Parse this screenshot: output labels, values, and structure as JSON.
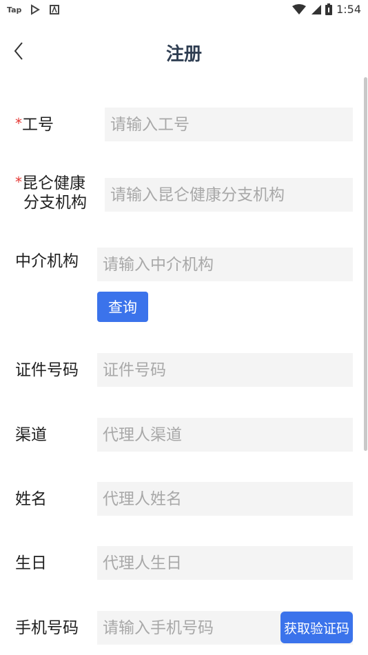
{
  "status_bar": {
    "app": "Tap",
    "time": "1:54"
  },
  "header": {
    "title": "注册"
  },
  "form": {
    "required_mark": "*",
    "employee_id": {
      "label": "工号",
      "placeholder": "请输入工号"
    },
    "branch": {
      "label_line1": "昆仑健康",
      "label_line2": "分支机构",
      "placeholder": "请输入昆仑健康分支机构"
    },
    "agency": {
      "label": "中介机构",
      "placeholder": "请输入中介机构"
    },
    "query_button": "查询",
    "id_number": {
      "label": "证件号码",
      "placeholder": "证件号码"
    },
    "channel": {
      "label": "渠道",
      "placeholder": "代理人渠道"
    },
    "name": {
      "label": "姓名",
      "placeholder": "代理人姓名"
    },
    "birthday": {
      "label": "生日",
      "placeholder": "代理人生日"
    },
    "phone": {
      "label": "手机号码",
      "placeholder": "请输入手机号码"
    },
    "get_code_button": "获取验证码"
  },
  "colors": {
    "primary": "#3b73eb",
    "required": "#e53935",
    "title": "#2f3e52",
    "input_bg": "#f4f4f4",
    "placeholder": "#a8a8a8"
  },
  "icons": [
    "play-store-icon",
    "a-icon",
    "wifi-icon",
    "signal-icon",
    "battery-icon",
    "back-chevron-icon"
  ]
}
